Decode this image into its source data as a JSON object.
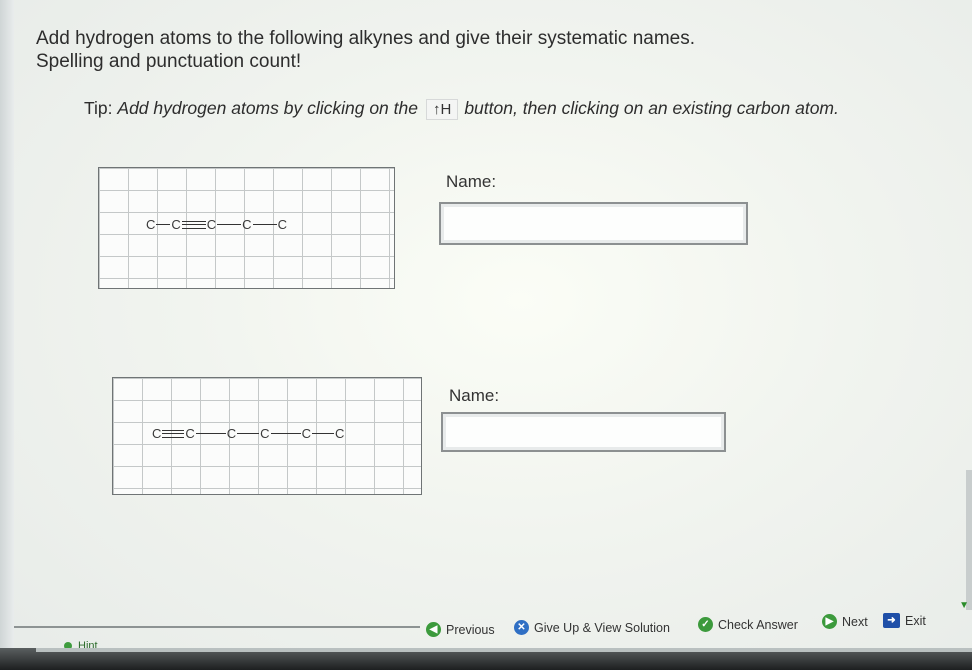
{
  "instructions": {
    "line1": "Add hydrogen atoms to the following alkynes and give their systematic names.",
    "line2": "Spelling and punctuation count!"
  },
  "tip": {
    "prefix": "Tip: ",
    "part1": "Add hydrogen atoms by clicking on the",
    "button_label": "↑H",
    "part2": "button, then clicking on an existing carbon atom."
  },
  "molecules": [
    {
      "atoms": [
        "C",
        "C",
        "C",
        "C",
        "C"
      ],
      "bonds": [
        "single",
        "triple",
        "single",
        "single"
      ]
    },
    {
      "atoms": [
        "C",
        "C",
        "C",
        "C",
        "C",
        "C"
      ],
      "bonds": [
        "triple",
        "single",
        "single",
        "single",
        "single"
      ]
    }
  ],
  "name_fields": [
    {
      "label": "Name:",
      "value": ""
    },
    {
      "label": "Name:",
      "value": ""
    }
  ],
  "footer": {
    "hint": "Hint",
    "previous": "Previous",
    "give_up": "Give Up & View Solution",
    "check_answer": "Check Answer",
    "next": "Next",
    "exit": "Exit"
  }
}
